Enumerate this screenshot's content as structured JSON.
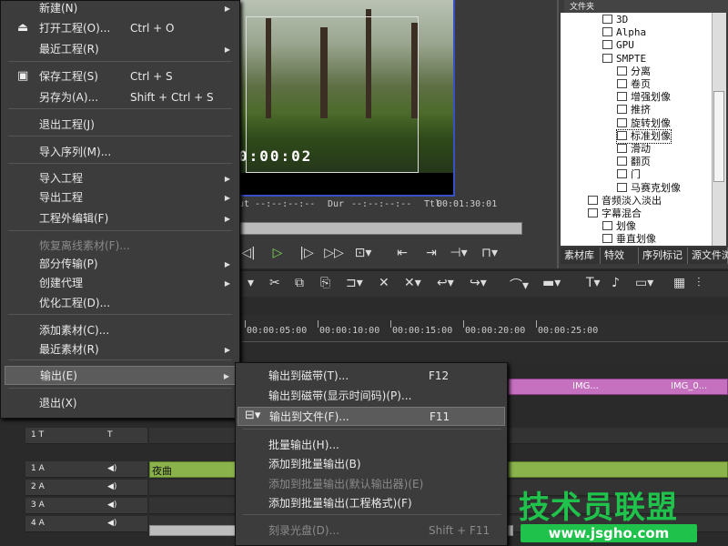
{
  "preview": {
    "timecode": "0:00:02",
    "timebar": {
      "out": "ut --:--:--:--",
      "dur_label": "Dur",
      "dur_value": "--:--:--:--",
      "ttl_label": "Ttl",
      "ttl_value": "00:01:30:01"
    }
  },
  "bin": {
    "header": "文件夹",
    "tree": [
      {
        "label": "3D",
        "indent": 1
      },
      {
        "label": "Alpha",
        "indent": 1
      },
      {
        "label": "GPU",
        "indent": 1
      },
      {
        "label": "SMPTE",
        "indent": 1
      },
      {
        "label": "分离",
        "indent": 2
      },
      {
        "label": "卷页",
        "indent": 2
      },
      {
        "label": "增强划像",
        "indent": 2
      },
      {
        "label": "推挤",
        "indent": 2
      },
      {
        "label": "旋转划像",
        "indent": 2
      },
      {
        "label": "标准划像",
        "indent": 2,
        "selected": true
      },
      {
        "label": "滑动",
        "indent": 2
      },
      {
        "label": "翻页",
        "indent": 2
      },
      {
        "label": "门",
        "indent": 2
      },
      {
        "label": "马赛克划像",
        "indent": 2
      },
      {
        "label": "音频淡入淡出",
        "indent": 0
      },
      {
        "label": "字幕混合",
        "indent": 0
      },
      {
        "label": "划像",
        "indent": 1
      },
      {
        "label": "垂直划像",
        "indent": 1
      }
    ],
    "tabs": [
      "素材库",
      "特效",
      "序列标记",
      "源文件浏"
    ]
  },
  "ruler": [
    "00:00:05:00",
    "00:00:10:00",
    "00:00:15:00",
    "00:00:20:00",
    "00:00:25:00"
  ],
  "tracks": [
    {
      "label": "1 T"
    },
    {
      "label": "1 A"
    },
    {
      "label": "2 A"
    },
    {
      "label": "3 A"
    },
    {
      "label": "4 A"
    }
  ],
  "clips": {
    "video_a": "IMG...",
    "video_b": "IMG_0...",
    "audio": "夜曲"
  },
  "main_menu": [
    {
      "label": "新建(N)",
      "shortcut": "",
      "arrow": true
    },
    {
      "label": "打开工程(O)...",
      "shortcut": "Ctrl + O"
    },
    {
      "label": "最近工程(R)",
      "shortcut": "",
      "arrow": true
    },
    {
      "label": "保存工程(S)",
      "shortcut": "Ctrl + S"
    },
    {
      "label": "另存为(A)...",
      "shortcut": "Shift + Ctrl + S"
    },
    {
      "label": "退出工程(J)",
      "shortcut": ""
    },
    {
      "label": "导入序列(M)...",
      "shortcut": ""
    },
    {
      "label": "导入工程",
      "shortcut": "",
      "arrow": true
    },
    {
      "label": "导出工程",
      "shortcut": "",
      "arrow": true
    },
    {
      "label": "工程外编辑(F)",
      "shortcut": "",
      "arrow": true
    },
    {
      "label": "恢复离线素材(F)...",
      "shortcut": "",
      "disabled": true
    },
    {
      "label": "部分传输(P)",
      "shortcut": "",
      "arrow": true
    },
    {
      "label": "创建代理",
      "shortcut": "",
      "arrow": true
    },
    {
      "label": "优化工程(D)...",
      "shortcut": ""
    },
    {
      "label": "添加素材(C)...",
      "shortcut": ""
    },
    {
      "label": "最近素材(R)",
      "shortcut": "",
      "arrow": true
    },
    {
      "label": "输出(E)",
      "shortcut": "",
      "arrow": true,
      "highlighted": true
    },
    {
      "label": "退出(X)",
      "shortcut": ""
    }
  ],
  "sub_menu": [
    {
      "label": "输出到磁带(T)...",
      "shortcut": "F12"
    },
    {
      "label": "输出到磁带(显示时间码)(P)...",
      "shortcut": ""
    },
    {
      "label": "输出到文件(F)...",
      "shortcut": "F11",
      "highlighted": true
    },
    {
      "label": "批量输出(H)...",
      "shortcut": ""
    },
    {
      "label": "添加到批量输出(B)",
      "shortcut": ""
    },
    {
      "label": "添加到批量输出(默认输出器)(E)",
      "shortcut": "",
      "disabled": true
    },
    {
      "label": "添加到批量输出(工程格式)(F)",
      "shortcut": ""
    },
    {
      "label": "刻录光盘(D)...",
      "shortcut": "Shift + F11",
      "disabled": true
    }
  ],
  "watermark": {
    "title": "技术员联盟",
    "url": "www.jsgho.com"
  },
  "colors": {
    "accent_blue": "#3850c8",
    "video_clip": "#c670c0",
    "audio_clip": "#8ab34c",
    "watermark": "#1fc24a"
  }
}
